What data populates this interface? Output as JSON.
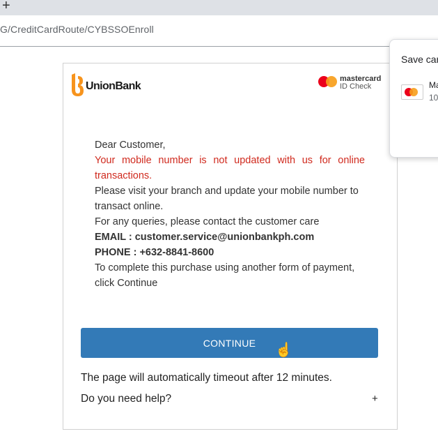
{
  "browser": {
    "new_tab_glyph": "+",
    "url": "G/CreditCardRoute/CYBSSOEnroll"
  },
  "popup": {
    "title": "Save car",
    "card_line1": "Ma",
    "card_line2": "10"
  },
  "auth": {
    "bank_name": "UnionBank",
    "network_line1": "mastercard",
    "network_line2": "ID Check",
    "greeting": "Dear Customer,",
    "warning": "Your mobile number is not updated with us for online transactions.",
    "instruction": "Please visit your branch and update your mobile number to transact online.",
    "queries": "For any queries, please contact the customer care",
    "email_line": "EMAIL : customer.service@unionbankph.com",
    "phone_line": "PHONE : +632-8841-8600",
    "alt_payment": "To complete this purchase using another form of payment, click Continue",
    "continue_label": "CONTINUE",
    "timeout_text": "The page will automatically timeout after 12 minutes.",
    "help_text": "Do you need help?",
    "help_toggle": "+"
  },
  "colors": {
    "brand_orange": "#f7941d",
    "warning_red": "#d02a1e",
    "button_blue": "#337ab7",
    "mastercard_red": "#eb001b",
    "mastercard_yellow": "#f79e1b"
  },
  "icons": [
    "new-tab-icon",
    "unionbank-logo-icon",
    "mastercard-logo-icon",
    "card-icon",
    "hand-cursor-icon"
  ]
}
